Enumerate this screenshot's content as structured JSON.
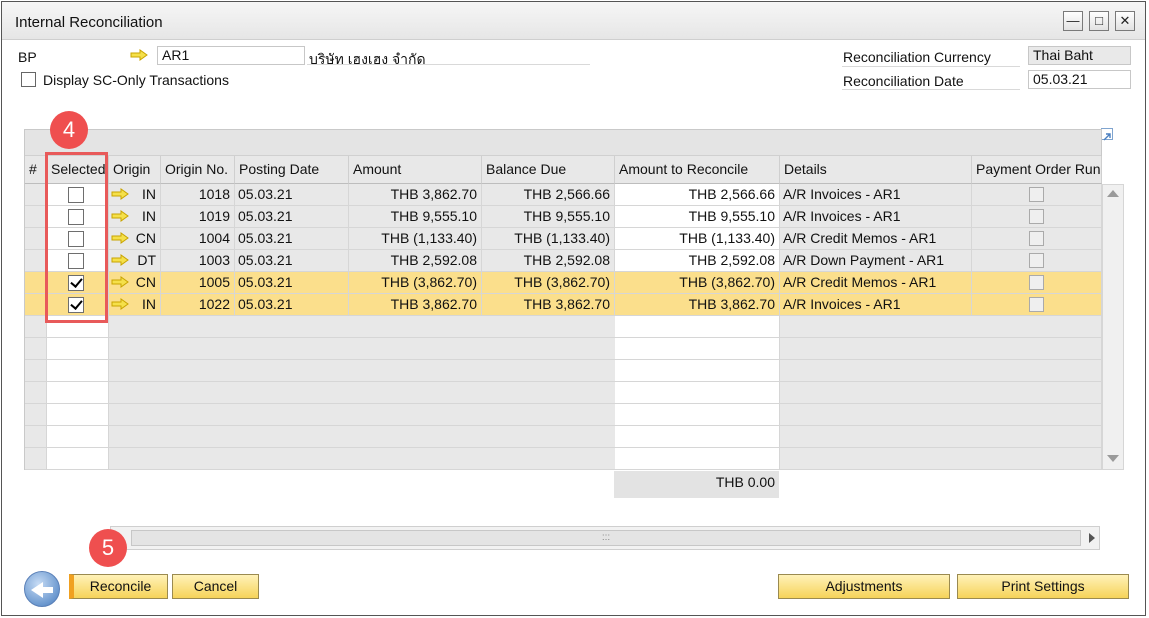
{
  "window": {
    "title": "Internal Reconciliation"
  },
  "header": {
    "bp_label": "BP",
    "bp_code": "AR1",
    "bp_name": "บริษัท เฮงเฮง จำกัด",
    "sc_only_label": "Display SC-Only Transactions",
    "sc_only_checked": false,
    "currency_label": "Reconciliation Currency",
    "currency_value": "Thai Baht",
    "date_label": "Reconciliation Date",
    "date_value": "05.03.21"
  },
  "grid": {
    "columns": [
      "#",
      "Selected",
      "Origin",
      "Origin No.",
      "Posting Date",
      "Amount",
      "Balance Due",
      "Amount to Reconcile",
      "Details",
      "Payment Order Run"
    ],
    "rows": [
      {
        "selected": false,
        "origin": "IN",
        "origin_no": "1018",
        "posting_date": "05.03.21",
        "amount": "THB  3,862.70",
        "balance_due": "THB  2,566.66",
        "to_reconcile": "THB  2,566.66",
        "details": "A/R Invoices - AR1",
        "highlight": false
      },
      {
        "selected": false,
        "origin": "IN",
        "origin_no": "1019",
        "posting_date": "05.03.21",
        "amount": "THB  9,555.10",
        "balance_due": "THB  9,555.10",
        "to_reconcile": "THB  9,555.10",
        "details": "A/R Invoices - AR1",
        "highlight": false
      },
      {
        "selected": false,
        "origin": "CN",
        "origin_no": "1004",
        "posting_date": "05.03.21",
        "amount": "THB (1,133.40)",
        "balance_due": "THB (1,133.40)",
        "to_reconcile": "THB (1,133.40)",
        "details": "A/R Credit Memos - AR1",
        "highlight": false
      },
      {
        "selected": false,
        "origin": "DT",
        "origin_no": "1003",
        "posting_date": "05.03.21",
        "amount": "THB  2,592.08",
        "balance_due": "THB  2,592.08",
        "to_reconcile": "THB  2,592.08",
        "details": "A/R Down Payment - AR1",
        "highlight": false
      },
      {
        "selected": true,
        "origin": "CN",
        "origin_no": "1005",
        "posting_date": "05.03.21",
        "amount": "THB (3,862.70)",
        "balance_due": "THB (3,862.70)",
        "to_reconcile": "THB (3,862.70)",
        "details": "A/R Credit Memos - AR1",
        "highlight": true
      },
      {
        "selected": true,
        "origin": "IN",
        "origin_no": "1022",
        "posting_date": "05.03.21",
        "amount": "THB  3,862.70",
        "balance_due": "THB  3,862.70",
        "to_reconcile": "THB  3,862.70",
        "details": "A/R Invoices - AR1",
        "highlight": true
      }
    ],
    "total": "THB 0.00"
  },
  "annotations": {
    "step4": "4",
    "step5": "5"
  },
  "buttons": {
    "reconcile": "Reconcile",
    "cancel": "Cancel",
    "adjustments": "Adjustments",
    "print_settings": "Print Settings"
  },
  "icons": {
    "link_arrow": "arrow-right-icon",
    "back": "back-arrow-icon"
  },
  "colors": {
    "highlight_row": "#fbdf8c",
    "button": "#f6d35a",
    "annotation": "#ef4f4f"
  }
}
